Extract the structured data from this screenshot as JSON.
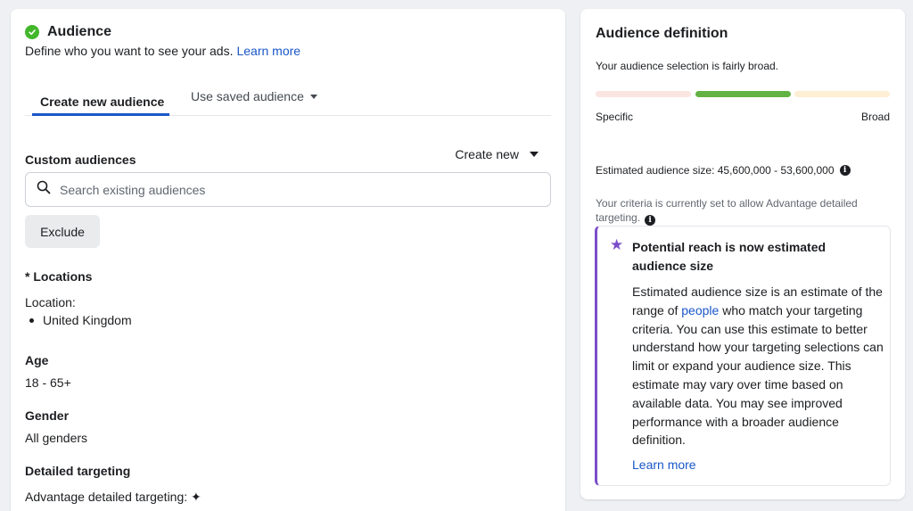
{
  "audience": {
    "title": "Audience",
    "subtitle": "Define who you want to see your ads.",
    "learn_more": "Learn more"
  },
  "tabs": [
    {
      "label": "Create new audience",
      "active": true
    },
    {
      "label": "Use saved audience",
      "active": false
    }
  ],
  "custom_audiences": {
    "label": "Custom audiences",
    "create_new": "Create new",
    "search_placeholder": "Search existing audiences",
    "exclude": "Exclude"
  },
  "locations": {
    "label": "* Locations",
    "sub": "Location:",
    "items": [
      "United Kingdom"
    ]
  },
  "age": {
    "label": "Age",
    "value": "18 - 65+"
  },
  "gender": {
    "label": "Gender",
    "value": "All genders"
  },
  "detailed": {
    "label": "Detailed targeting",
    "advantage": "Advantage detailed targeting: ✦"
  },
  "definition": {
    "title": "Audience definition",
    "text": "Your audience selection is fairly broad.",
    "meter_level": "broad",
    "specific": "Specific",
    "broad": "Broad",
    "estimated": "Estimated audience size: 45,600,000 - 53,600,000",
    "criteria": "Your criteria is currently set to allow Advantage detailed targeting."
  },
  "reach": {
    "title": "Potential reach is now estimated audience size",
    "body_pre": "Estimated audience size is an estimate of the range of",
    "body_link": "people",
    "body_post": "who match your targeting criteria. You can use this estimate to better understand how your targeting selections can limit or expand your audience size. This estimate may vary over time based on available data. You may see improved performance with a broader audience definition.",
    "learn_more": "Learn more"
  },
  "colors": {
    "accent": "#1a56c9",
    "success": "#42b72a",
    "purple": "#7b4fc9",
    "meter_active": "#63b244"
  },
  "icons": [
    "check-circle-icon",
    "search-icon",
    "caret-down-icon",
    "info-icon",
    "star-icon"
  ]
}
